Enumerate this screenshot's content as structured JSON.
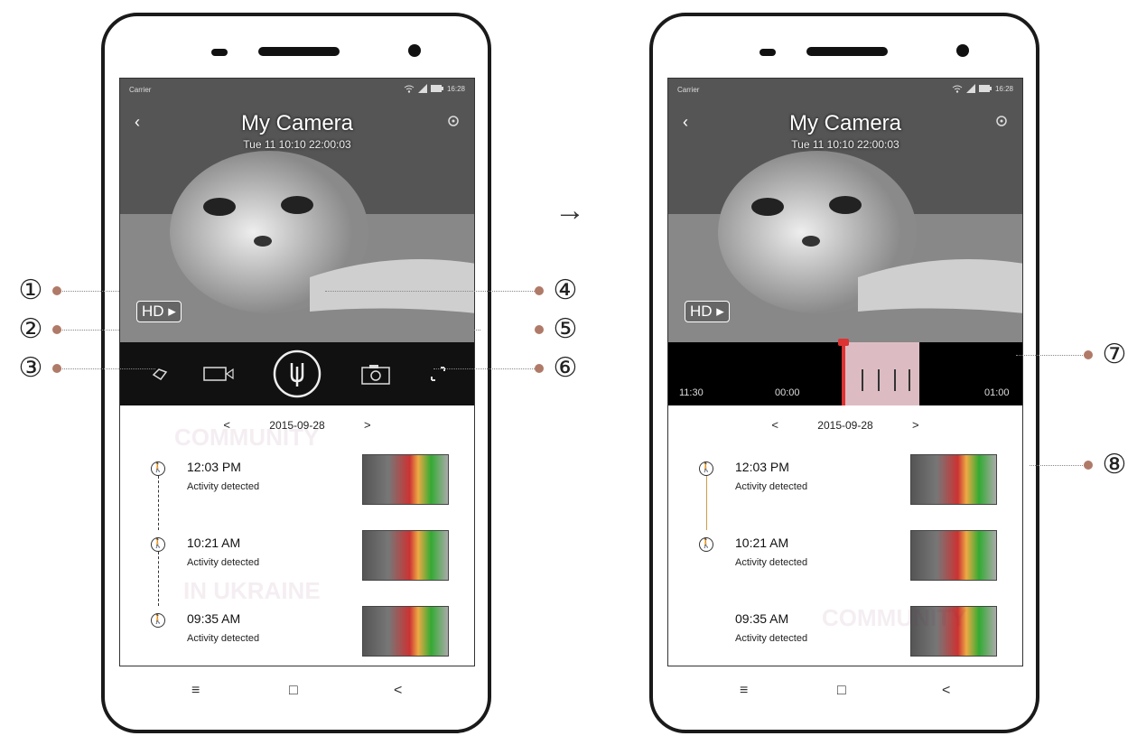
{
  "left_phone": {
    "status": {
      "carrier": "Carrier",
      "time": "16:28"
    },
    "camera": {
      "title": "My Camera",
      "timestamp": "Tue 11 10:10 22:00:03",
      "hd_label": "HD"
    },
    "controls": [
      {
        "name": "speaker-mute-icon"
      },
      {
        "name": "record-video-icon"
      },
      {
        "name": "talk-microphone-icon"
      },
      {
        "name": "snapshot-camera-icon"
      },
      {
        "name": "fullscreen-icon"
      }
    ],
    "date_nav": {
      "prev": "<",
      "date": "2015-09-28",
      "next": ">"
    },
    "events": [
      {
        "time": "12:03 PM",
        "desc": "Activity detected"
      },
      {
        "time": "10:21 AM",
        "desc": "Activity detected"
      },
      {
        "time": "09:35 AM",
        "desc": "Activity detected"
      }
    ],
    "navbar": {
      "menu": "≡",
      "home": "□",
      "back": "<"
    }
  },
  "right_phone": {
    "status": {
      "carrier": "Carrier",
      "time": "16:28"
    },
    "camera": {
      "title": "My Camera",
      "timestamp": "Tue 11 10:10 22:00:03",
      "hd_label": "HD"
    },
    "timeline": {
      "labels": [
        "11:30",
        "00:00",
        "01:00"
      ]
    },
    "date_nav": {
      "prev": "<",
      "date": "2015-09-28",
      "next": ">"
    },
    "events": [
      {
        "time": "12:03 PM",
        "desc": "Activity detected"
      },
      {
        "time": "10:21 AM",
        "desc": "Activity detected"
      },
      {
        "time": "09:35 AM",
        "desc": "Activity detected"
      }
    ],
    "navbar": {
      "menu": "≡",
      "home": "□",
      "back": "<"
    }
  },
  "transition_arrow": "→",
  "callouts": {
    "c1": "①",
    "c2": "②",
    "c3": "③",
    "c4": "④",
    "c5": "⑤",
    "c6": "⑥",
    "c7": "⑦",
    "c8": "⑧"
  },
  "watermarks": [
    "COMMUNITY",
    "IN UKRAINE",
    "COMMUNITY"
  ]
}
